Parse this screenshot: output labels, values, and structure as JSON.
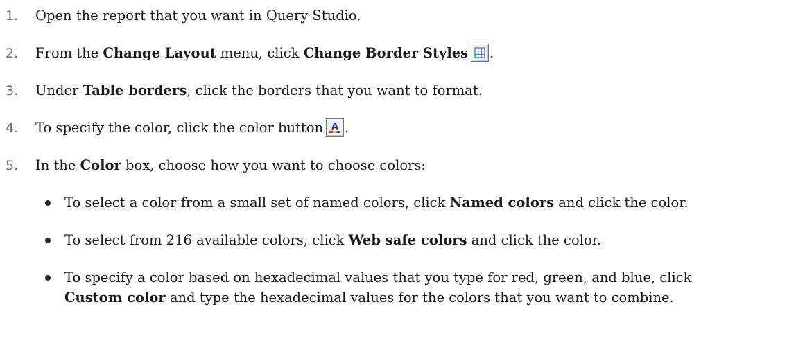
{
  "steps": [
    {
      "num": "1.",
      "text": "Open the report that you want in Query Studio."
    },
    {
      "num": "2.",
      "pre": "From the ",
      "b1": "Change Layout",
      "mid": " menu, click ",
      "b2": "Change Border Styles",
      "post": "."
    },
    {
      "num": "3.",
      "pre": "Under ",
      "b1": "Table borders",
      "post": ", click the borders that you want to format."
    },
    {
      "num": "4.",
      "pre": "To specify the color, click the color button",
      "post": "."
    },
    {
      "num": "5.",
      "pre": "In the ",
      "b1": "Color",
      "post": " box, choose how you want to choose colors:"
    }
  ],
  "bullets": [
    {
      "pre": "To select a color from a small set of named colors, click ",
      "b": "Named colors",
      "post": " and click the color."
    },
    {
      "pre": "To select from 216 available colors, click ",
      "b": "Web safe colors",
      "post": " and click the color."
    },
    {
      "pre": "To specify a color based on hexadecimal values that you type for red, green, and blue, click"
    },
    {
      "b": "Custom color",
      "post": " and type the hexadecimal values for the colors that you want to combine."
    }
  ],
  "icons": {
    "border_styles": "table-grid-icon",
    "color": "font-color-icon",
    "color_letter": "A",
    "colors": {
      "grid": "#3a67c9",
      "red": "#e0302a",
      "yellow": "#f2c500",
      "blue": "#2c4fd1",
      "letter": "#1a3da8"
    }
  }
}
